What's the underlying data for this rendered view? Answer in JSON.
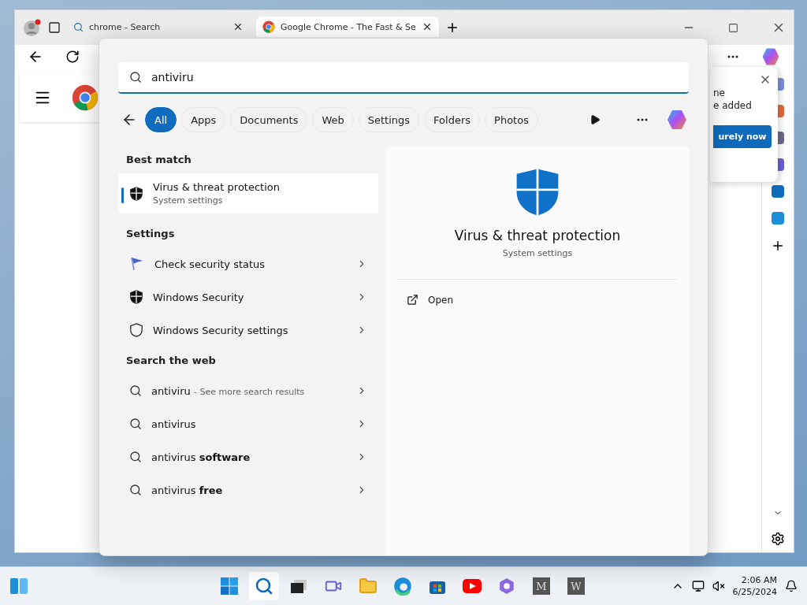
{
  "browser": {
    "tabs": [
      {
        "label": "chrome - Search",
        "kind": "search",
        "selected": false
      },
      {
        "label": "Google Chrome - The Fast & Se",
        "kind": "chrome",
        "selected": true
      }
    ],
    "popup": {
      "lines": [
        "ne",
        "e added"
      ],
      "button": "urely now"
    }
  },
  "search": {
    "value": "antiviru",
    "filters": [
      {
        "label": "All",
        "selected": true
      },
      {
        "label": "Apps",
        "selected": false
      },
      {
        "label": "Documents",
        "selected": false
      },
      {
        "label": "Web",
        "selected": false
      },
      {
        "label": "Settings",
        "selected": false
      },
      {
        "label": "Folders",
        "selected": false
      },
      {
        "label": "Photos",
        "selected": false
      }
    ]
  },
  "best_match": {
    "heading": "Best match",
    "title": "Virus & threat protection",
    "subtitle": "System settings",
    "selected": true
  },
  "settings": {
    "heading": "Settings",
    "items": [
      {
        "label": "Check security status",
        "kind": "flag"
      },
      {
        "label": "Windows Security",
        "kind": "shield-filled"
      },
      {
        "label": "Windows Security settings",
        "kind": "shield-outline"
      }
    ]
  },
  "web": {
    "heading": "Search the web",
    "items": [
      {
        "text": "antiviru",
        "hint": "- See more search results"
      },
      {
        "text": "antivirus"
      },
      {
        "text": "antivirus **software**"
      },
      {
        "text": "antivirus **free**"
      }
    ]
  },
  "preview": {
    "title": "Virus & threat protection",
    "subtitle": "System settings",
    "actions": [
      "Open"
    ]
  },
  "taskbar": {
    "apps": [
      {
        "kind": "start",
        "selected": false
      },
      {
        "kind": "search",
        "selected": true
      },
      {
        "kind": "taskview",
        "selected": false
      },
      {
        "kind": "meet",
        "selected": false
      },
      {
        "kind": "folder",
        "selected": false
      },
      {
        "kind": "edge",
        "selected": false
      },
      {
        "kind": "store",
        "selected": false
      },
      {
        "kind": "youtube",
        "selected": false
      },
      {
        "kind": "copilot",
        "selected": false
      },
      {
        "kind": "letter",
        "label": "M",
        "selected": false
      },
      {
        "kind": "letter",
        "label": "W",
        "selected": false
      }
    ],
    "time": "2:06 AM",
    "date": "6/25/2024"
  }
}
